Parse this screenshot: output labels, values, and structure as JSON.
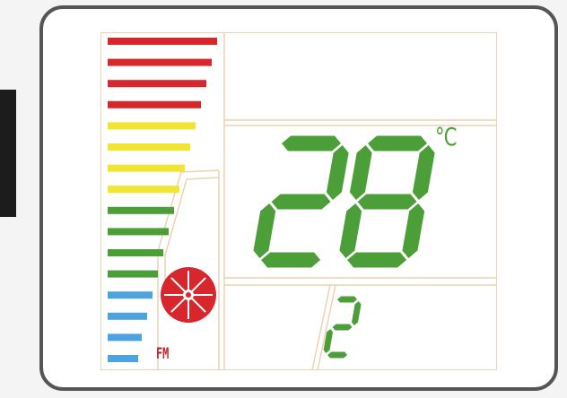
{
  "display": {
    "temperature": "28",
    "unit": "°C",
    "fan_speed": "2",
    "mode": "FM"
  },
  "level_bars": {
    "lit": 16,
    "total": 16,
    "colors": {
      "red": "#d7262c",
      "yellow": "#f0e533",
      "green": "#4c9f38",
      "blue": "#4da3e0"
    }
  },
  "colors": {
    "segment_on": "#4c9f38",
    "panel_border": "#ecd3b0",
    "frame": "#555555",
    "fan_icon": "#d7262c"
  },
  "icons": [
    "fan-icon"
  ]
}
